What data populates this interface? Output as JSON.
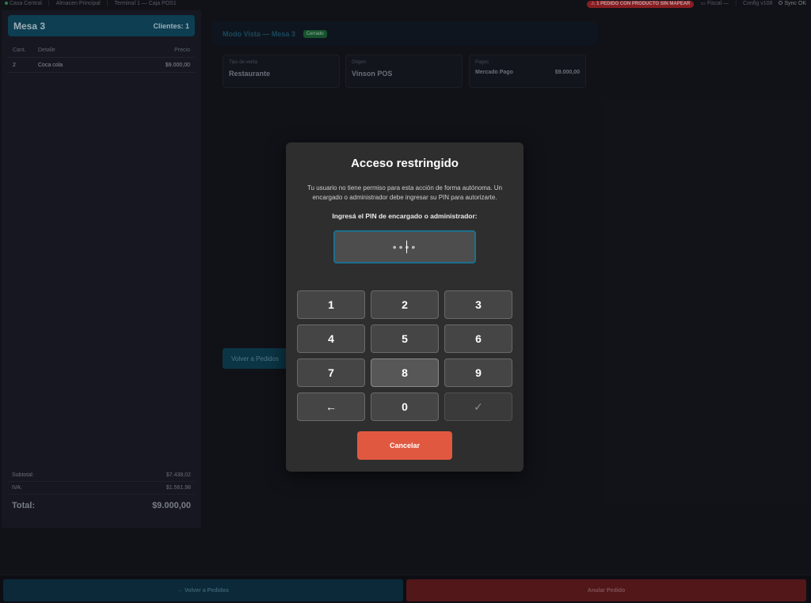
{
  "topbar": {
    "location": "Casa Central",
    "warehouse": "Almacen Principal",
    "terminal": "Terminal 1 — Caja POS1",
    "alert": "⚠ 1 PEDIDO CON PRODUCTO SIN MAPEAR",
    "fiscal": "Fiscal —",
    "config": "Config v108",
    "sync": "Sync OK"
  },
  "order": {
    "title": "Mesa 3",
    "clients": "Clientes: 1",
    "columns": {
      "qty": "Cant.",
      "detail": "Detalle",
      "price": "Precio"
    },
    "items": [
      {
        "qty": "2",
        "detail": "Coca cola",
        "price": "$9.000,00"
      }
    ],
    "subtotal_label": "Subtotal:",
    "subtotal_value": "$7.438,02",
    "iva_label": "IVA:",
    "iva_value": "$1.561,98",
    "total_label": "Total:",
    "total_value": "$9.000,00"
  },
  "view": {
    "title": "Modo Vista — Mesa 3",
    "status_badge": "Cerrado",
    "sale_type_label": "Tipo de venta",
    "sale_type_value": "Restaurante",
    "origin_label": "Origen",
    "origin_value": "Vinson POS",
    "payments_label": "Pagos",
    "payment_method": "Mercado Pago",
    "payment_amount": "$9.000,00",
    "back_label": "Volver a Pedidos"
  },
  "bottom": {
    "back_label": "← Volver a Pedidos",
    "void_label": "Anular Pedido"
  },
  "modal": {
    "title": "Acceso restringido",
    "message": "Tu usuario no tiene permiso para esta acción de forma autónoma. Un encargado o administrador debe ingresar su PIN para autorizarte.",
    "prompt": "Ingresá el PIN de encargado o administrador:",
    "pin_mask": "••••",
    "keys": [
      "1",
      "2",
      "3",
      "4",
      "5",
      "6",
      "7",
      "8",
      "9",
      "←",
      "0",
      "✓"
    ],
    "cancel_label": "Cancelar"
  },
  "colors": {
    "accent": "#0f5068",
    "danger": "#e05840",
    "success": "#1c6b3a",
    "modal_bg": "#2e2e2e"
  }
}
